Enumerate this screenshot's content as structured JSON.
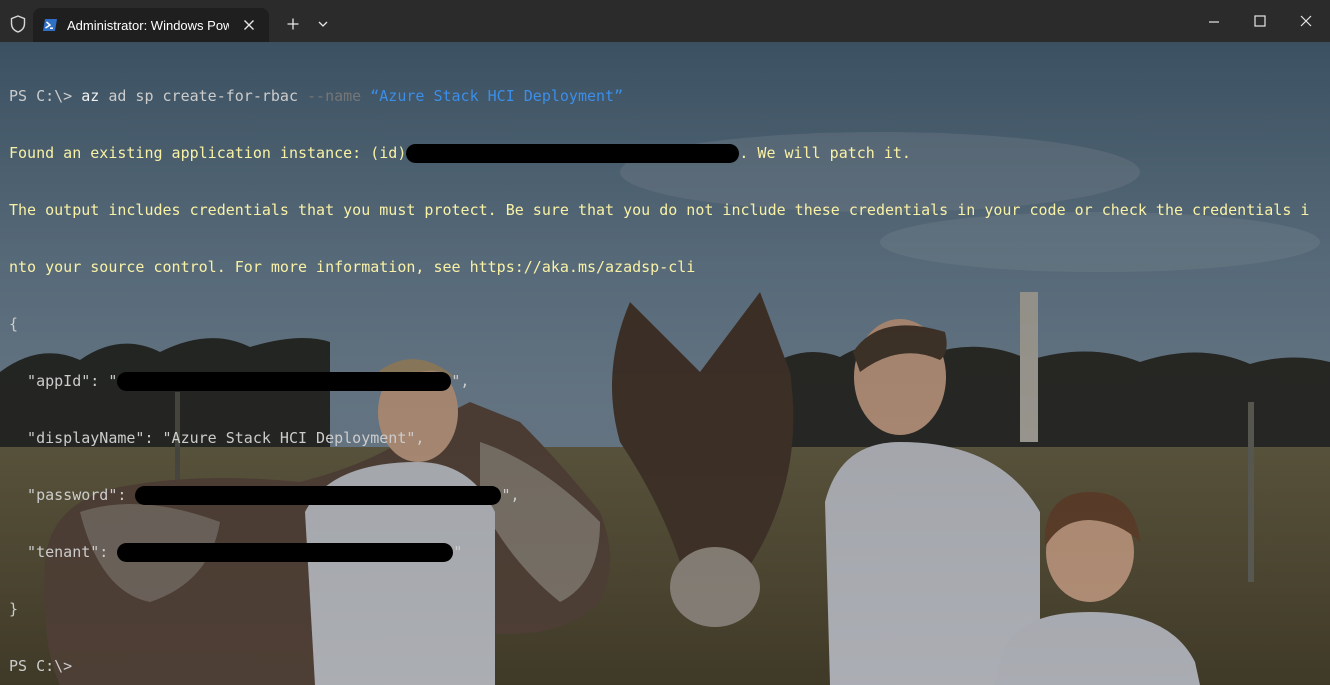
{
  "window": {
    "tab_title": "Administrator: Windows PowerShell"
  },
  "terminal": {
    "prompt": "PS C:\\>",
    "command": {
      "exe": "az",
      "args": "ad sp create-for-rbac",
      "param": "--name",
      "value": "“Azure Stack HCI Deployment”"
    },
    "found_prefix": "Found an existing application instance: (id)",
    "found_suffix": ". We will patch it.",
    "warning_line1": "The output includes credentials that you must protect. Be sure that you do not include these credentials in your code or check the credentials i",
    "warning_line2": "nto your source control. For more information, see https://aka.ms/azadsp-cli",
    "json_open": "{",
    "appId_key": "  \"appId\": ",
    "appId_pre": "\"",
    "appId_post": "\",",
    "displayName_line": "  \"displayName\": \"Azure Stack HCI Deployment\",",
    "password_key": "  \"password\": ",
    "password_post": "\",",
    "tenant_key": "  \"tenant\": ",
    "tenant_post": "\"",
    "json_close": "}",
    "final_prompt": "PS C:\\>"
  },
  "colors": {
    "titlebar": "#2b2b2b",
    "tab": "#1f1f1f",
    "output_yellow": "#f9f1a5",
    "string_blue": "#3b8eea",
    "default_text": "#cccccc"
  },
  "icons": {
    "shield": "shield-icon",
    "powershell": "powershell-icon",
    "close": "close-icon",
    "plus": "plus-icon",
    "chevron": "chevron-down-icon",
    "minimize": "minimize-icon",
    "maximize": "maximize-icon",
    "window_close": "window-close-icon"
  }
}
